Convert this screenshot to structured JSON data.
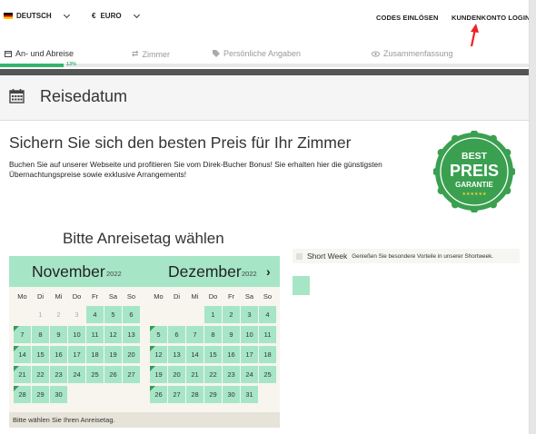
{
  "topbar": {
    "language": "DEUTSCH",
    "currency_symbol": "€",
    "currency": "EURO",
    "codes_link": "CODES EINLÖSEN",
    "account_link": "KUNDENKONTO LOGIN"
  },
  "steps": {
    "items": [
      {
        "label": "An- und Abreise",
        "icon": "calendar-icon",
        "active": true
      },
      {
        "label": "Zimmer",
        "icon": "swap-icon",
        "active": false
      },
      {
        "label": "Persönliche Angaben",
        "icon": "tag-icon",
        "active": false
      },
      {
        "label": "Zusammenfassung",
        "icon": "eye-icon",
        "active": false
      }
    ],
    "progress_percent": 13,
    "progress_label": "13%"
  },
  "header": {
    "title": "Reisedatum"
  },
  "promo": {
    "title": "Sichern Sie sich den besten Preis für Ihr Zimmer",
    "text": "Buchen Sie auf unserer Webseite und profitieren Sie vom Direk-Bucher Bonus! Sie erhalten hier die günstigsten Übernachtungspreise sowie exklusive Arrangements!"
  },
  "badge": {
    "line1": "BEST",
    "line2": "PREIS",
    "line3": "GARANTIE",
    "stars": "★★★★★★"
  },
  "calendar": {
    "heading": "Bitte Anreisetag wählen",
    "weekdays": [
      "Mo",
      "Di",
      "Mi",
      "Do",
      "Fr",
      "Sa",
      "So"
    ],
    "months": [
      {
        "name": "November",
        "year": "2022",
        "days": [
          {
            "d": "1",
            "s": "past"
          },
          {
            "d": "2",
            "s": "past"
          },
          {
            "d": "3",
            "s": "past"
          },
          {
            "d": "4",
            "s": "avail"
          },
          {
            "d": "5",
            "s": "avail"
          },
          {
            "d": "6",
            "s": "avail"
          },
          {
            "d": "7",
            "s": "flag"
          },
          {
            "d": "8",
            "s": "avail"
          },
          {
            "d": "9",
            "s": "avail"
          },
          {
            "d": "10",
            "s": "avail"
          },
          {
            "d": "11",
            "s": "avail"
          },
          {
            "d": "12",
            "s": "avail"
          },
          {
            "d": "13",
            "s": "avail"
          },
          {
            "d": "14",
            "s": "flag"
          },
          {
            "d": "15",
            "s": "avail"
          },
          {
            "d": "16",
            "s": "avail"
          },
          {
            "d": "17",
            "s": "avail"
          },
          {
            "d": "18",
            "s": "avail"
          },
          {
            "d": "19",
            "s": "avail"
          },
          {
            "d": "20",
            "s": "avail"
          },
          {
            "d": "21",
            "s": "flag"
          },
          {
            "d": "22",
            "s": "avail"
          },
          {
            "d": "23",
            "s": "avail"
          },
          {
            "d": "24",
            "s": "avail"
          },
          {
            "d": "25",
            "s": "avail"
          },
          {
            "d": "26",
            "s": "avail"
          },
          {
            "d": "27",
            "s": "avail"
          },
          {
            "d": "28",
            "s": "flag"
          },
          {
            "d": "29",
            "s": "avail"
          },
          {
            "d": "30",
            "s": "avail"
          }
        ],
        "first_weekday": 1
      },
      {
        "name": "Dezember",
        "year": "2022",
        "days": [
          {
            "d": "1",
            "s": "avail"
          },
          {
            "d": "2",
            "s": "avail"
          },
          {
            "d": "3",
            "s": "avail"
          },
          {
            "d": "4",
            "s": "avail"
          },
          {
            "d": "5",
            "s": "flag"
          },
          {
            "d": "6",
            "s": "avail"
          },
          {
            "d": "7",
            "s": "avail"
          },
          {
            "d": "8",
            "s": "avail"
          },
          {
            "d": "9",
            "s": "avail"
          },
          {
            "d": "10",
            "s": "avail"
          },
          {
            "d": "11",
            "s": "avail"
          },
          {
            "d": "12",
            "s": "flag"
          },
          {
            "d": "13",
            "s": "avail"
          },
          {
            "d": "14",
            "s": "avail"
          },
          {
            "d": "15",
            "s": "avail"
          },
          {
            "d": "16",
            "s": "avail"
          },
          {
            "d": "17",
            "s": "avail"
          },
          {
            "d": "18",
            "s": "avail"
          },
          {
            "d": "19",
            "s": "flag"
          },
          {
            "d": "20",
            "s": "avail"
          },
          {
            "d": "21",
            "s": "avail"
          },
          {
            "d": "22",
            "s": "avail"
          },
          {
            "d": "23",
            "s": "avail"
          },
          {
            "d": "24",
            "s": "avail"
          },
          {
            "d": "25",
            "s": "avail"
          },
          {
            "d": "26",
            "s": "flag"
          },
          {
            "d": "27",
            "s": "avail"
          },
          {
            "d": "28",
            "s": "avail"
          },
          {
            "d": "29",
            "s": "avail"
          },
          {
            "d": "30",
            "s": "avail"
          },
          {
            "d": "31",
            "s": "avail"
          }
        ],
        "first_weekday": 3
      }
    ],
    "next_label": "›",
    "footer": "Bitte wählen Sie Ihren Anreisetag."
  },
  "legend": {
    "name": "Short Week",
    "description": "Genießen Sie besondere Vorteile in unserer Shortweek."
  },
  "colors": {
    "accent": "#35b46e",
    "available": "#a6e6c7",
    "badge_green": "#3aa050"
  }
}
